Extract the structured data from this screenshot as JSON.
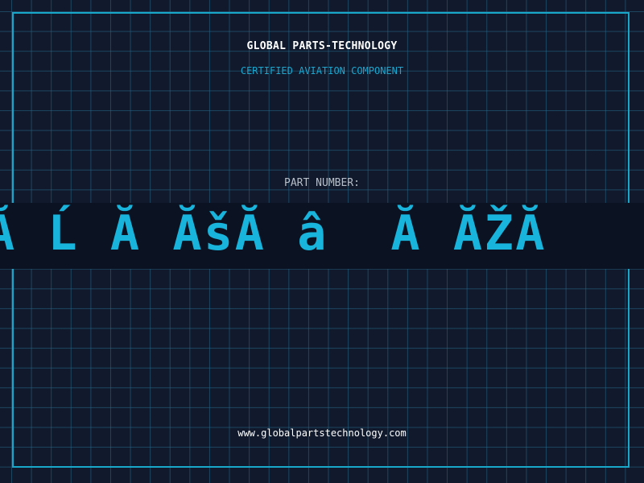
{
  "header": {
    "company": "GLOBAL PARTS-TECHNOLOGY",
    "subtitle": "CERTIFIED AVIATION COMPONENT"
  },
  "part": {
    "label": "PART NUMBER:",
    "value": "Ă Ĺ Ă ĂšĂ â  Ă ĂŽĂ"
  },
  "footer": {
    "url": "www.globalpartstechnology.com"
  },
  "colors": {
    "background": "#101a2c",
    "grid": "#28698c",
    "accent": "#19a7c9",
    "text_white": "#ffffff",
    "text_gray": "#b8bfc9"
  }
}
